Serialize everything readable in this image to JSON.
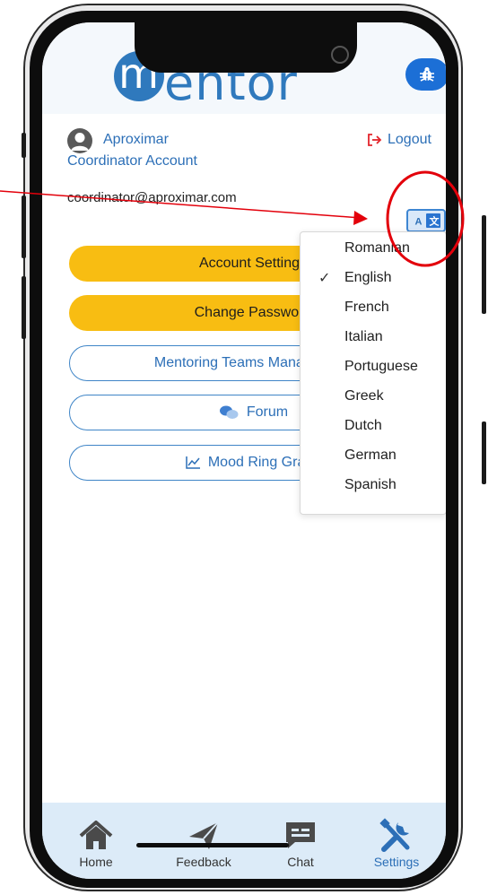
{
  "header": {
    "logo_text": "entor",
    "logo_initial": "m",
    "logo_plus": "+",
    "bug_icon": "bug-icon"
  },
  "account": {
    "name": "Aproximar",
    "role": "Coordinator Account",
    "email": "coordinator@aproximar.com",
    "logout_label": "Logout"
  },
  "menu": {
    "account_settings": "Account Settings",
    "change_password": "Change Password",
    "mentoring_teams": "Mentoring Teams Management",
    "forum": "Forum",
    "mood_ring": "Mood Ring Graph"
  },
  "language_menu": {
    "selected": "English",
    "options": [
      "Romanian",
      "English",
      "French",
      "Italian",
      "Portuguese",
      "Greek",
      "Dutch",
      "German",
      "Spanish"
    ]
  },
  "bottom_nav": {
    "items": [
      {
        "label": "Home",
        "icon": "home-icon"
      },
      {
        "label": "Feedback",
        "icon": "send-icon"
      },
      {
        "label": "Chat",
        "icon": "chat-icon"
      },
      {
        "label": "Settings",
        "icon": "tools-icon"
      }
    ],
    "active": "Settings"
  },
  "colors": {
    "brand_blue": "#2f79bd",
    "accent_yellow": "#f8bd12",
    "annotation_red": "#e3000b",
    "nav_background": "#dcebf8"
  }
}
